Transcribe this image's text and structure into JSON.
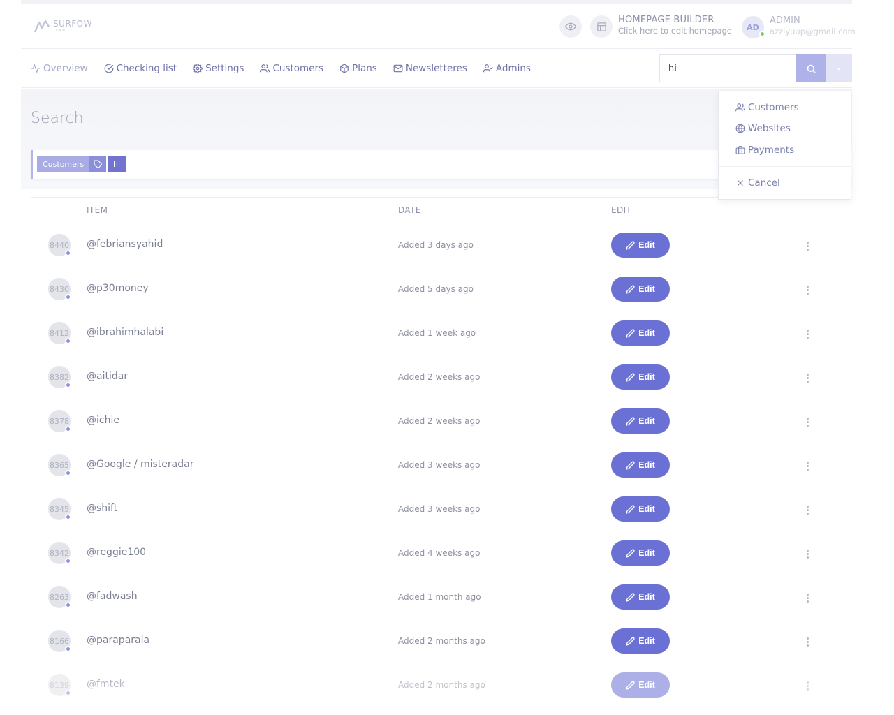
{
  "header": {
    "logo": {
      "name": "SURFOW",
      "sub": "TEAM"
    },
    "homepage_builder": {
      "title": "HOMEPAGE BUILDER",
      "subtitle": "Click here to edit homepage"
    },
    "admin": {
      "initials": "AD",
      "title": "ADMIN",
      "email": "azziyuup@gmail.com"
    }
  },
  "nav": {
    "items": [
      {
        "label": "Overview",
        "icon": "activity-icon"
      },
      {
        "label": "Checking list",
        "icon": "check-circle-icon"
      },
      {
        "label": "Settings",
        "icon": "gear-icon"
      },
      {
        "label": "Customers",
        "icon": "users-icon"
      },
      {
        "label": "Plans",
        "icon": "box-icon"
      },
      {
        "label": "Newsletteres",
        "icon": "mail-icon"
      },
      {
        "label": "Admins",
        "icon": "user-check-icon"
      }
    ]
  },
  "search": {
    "value": "hi"
  },
  "page": {
    "title": "Search",
    "filter": {
      "category": "Customers",
      "query": "hi"
    }
  },
  "dropdown": {
    "items": [
      {
        "label": "Customers",
        "icon": "users-icon"
      },
      {
        "label": "Websites",
        "icon": "globe-icon"
      },
      {
        "label": "Payments",
        "icon": "briefcase-icon"
      }
    ],
    "cancel": "Cancel"
  },
  "table": {
    "headers": {
      "item": "ITEM",
      "date": "DATE",
      "edit": "EDIT"
    },
    "edit_label": "Edit",
    "rows": [
      {
        "id": "8440",
        "item": "@febriansyahid",
        "date": "Added 3 days ago"
      },
      {
        "id": "8430",
        "item": "@p30money",
        "date": "Added 5 days ago"
      },
      {
        "id": "8412",
        "item": "@ibrahimhalabi",
        "date": "Added 1 week ago"
      },
      {
        "id": "8382",
        "item": "@aitidar",
        "date": "Added 2 weeks ago"
      },
      {
        "id": "8378",
        "item": "@ichie",
        "date": "Added 2 weeks ago"
      },
      {
        "id": "8365",
        "item": "@Google / misteradar",
        "date": "Added 3 weeks ago"
      },
      {
        "id": "8345",
        "item": "@shift",
        "date": "Added 3 weeks ago"
      },
      {
        "id": "8342",
        "item": "@reggie100",
        "date": "Added 4 weeks ago"
      },
      {
        "id": "8263",
        "item": "@fadwash",
        "date": "Added 1 month ago"
      },
      {
        "id": "8166",
        "item": "@paraparala",
        "date": "Added 2 months ago"
      },
      {
        "id": "8139",
        "item": "@fmtek",
        "date": "Added 2 months ago"
      }
    ]
  },
  "colors": {
    "accent": "#6b71d4",
    "accent_light": "#aeb2e8",
    "online": "#7bcf6a"
  }
}
